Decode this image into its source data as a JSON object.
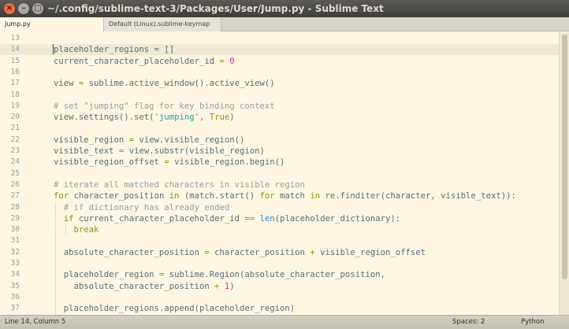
{
  "window": {
    "title": "~/.config/sublime-text-3/Packages/User/Jump.py - Sublime Text",
    "controls": [
      "×",
      "–",
      "□"
    ]
  },
  "tabs": [
    {
      "label": "Jump.py",
      "active": true
    },
    {
      "label": "Default (Linux).sublime-keymap",
      "active": false
    }
  ],
  "editor": {
    "current_line": 14,
    "lines": [
      {
        "n": "13",
        "tokens": []
      },
      {
        "n": "14",
        "tokens": [
          [
            "",
            "placeholder_regions = []"
          ]
        ]
      },
      {
        "n": "15",
        "tokens": [
          [
            "",
            "current_character_placeholder_id "
          ],
          [
            "op",
            "="
          ],
          [
            "",
            " "
          ],
          [
            "num",
            "0"
          ]
        ]
      },
      {
        "n": "16",
        "tokens": []
      },
      {
        "n": "17",
        "tokens": [
          [
            "",
            "view "
          ],
          [
            "op",
            "="
          ],
          [
            "",
            " sublime.active_window().active_view()"
          ]
        ]
      },
      {
        "n": "18",
        "tokens": []
      },
      {
        "n": "19",
        "tokens": [
          [
            "cmt",
            "# set \"jumping\" flag for key binding context"
          ]
        ]
      },
      {
        "n": "20",
        "tokens": [
          [
            "",
            "view.settings().set("
          ],
          [
            "str",
            "'jumping'"
          ],
          [
            "",
            ", "
          ],
          [
            "bool",
            "True"
          ],
          [
            "",
            ")"
          ]
        ]
      },
      {
        "n": "21",
        "tokens": []
      },
      {
        "n": "22",
        "tokens": [
          [
            "",
            "visible_region "
          ],
          [
            "op",
            "="
          ],
          [
            "",
            " view.visible_region()"
          ]
        ]
      },
      {
        "n": "23",
        "tokens": [
          [
            "",
            "visible_text "
          ],
          [
            "op",
            "="
          ],
          [
            "",
            " view.substr(visible_region)"
          ]
        ]
      },
      {
        "n": "24",
        "tokens": [
          [
            "",
            "visible_region_offset "
          ],
          [
            "op",
            "="
          ],
          [
            "",
            " visible_region.begin()"
          ]
        ]
      },
      {
        "n": "25",
        "tokens": []
      },
      {
        "n": "26",
        "tokens": [
          [
            "cmt",
            "# iterate all matched characters in visible region"
          ]
        ]
      },
      {
        "n": "27",
        "tokens": [
          [
            "kw",
            "for"
          ],
          [
            "",
            " character_position "
          ],
          [
            "kw",
            "in"
          ],
          [
            "",
            " (match.start() "
          ],
          [
            "kw",
            "for"
          ],
          [
            "",
            " match "
          ],
          [
            "kw",
            "in"
          ],
          [
            "",
            " re.finditer(character, visible_text)):"
          ]
        ]
      },
      {
        "n": "28",
        "tokens": [
          [
            "",
            "  "
          ],
          [
            "cmt",
            "# if dictionary has already ended"
          ]
        ]
      },
      {
        "n": "29",
        "tokens": [
          [
            "",
            "  "
          ],
          [
            "kw",
            "if"
          ],
          [
            "",
            " current_character_placeholder_id "
          ],
          [
            "op",
            "=="
          ],
          [
            "",
            " "
          ],
          [
            "fn",
            "len"
          ],
          [
            "",
            "(placeholder_dictionary):"
          ]
        ]
      },
      {
        "n": "30",
        "tokens": [
          [
            "",
            "    "
          ],
          [
            "kw",
            "break"
          ]
        ]
      },
      {
        "n": "31",
        "tokens": []
      },
      {
        "n": "32",
        "tokens": [
          [
            "",
            "  absolute_character_position "
          ],
          [
            "op",
            "="
          ],
          [
            "",
            " character_position "
          ],
          [
            "op",
            "+"
          ],
          [
            "",
            " visible_region_offset"
          ]
        ]
      },
      {
        "n": "33",
        "tokens": []
      },
      {
        "n": "34",
        "tokens": [
          [
            "",
            "  placeholder_region "
          ],
          [
            "op",
            "="
          ],
          [
            "",
            " sublime.Region(absolute_character_position,"
          ]
        ]
      },
      {
        "n": "35",
        "tokens": [
          [
            "",
            "    absolute_character_position "
          ],
          [
            "op",
            "+"
          ],
          [
            "",
            " "
          ],
          [
            "num",
            "1"
          ],
          [
            "",
            ")"
          ]
        ]
      },
      {
        "n": "36",
        "tokens": []
      },
      {
        "n": "37",
        "tokens": [
          [
            "",
            "  placeholder_regions.append(placeholder_region)"
          ]
        ]
      }
    ]
  },
  "status": {
    "position": "Line 14, Column 5",
    "spaces": "Spaces: 2",
    "syntax": "Python"
  },
  "scroll": {
    "position": 0.0,
    "visible_fraction": 0.88
  },
  "colors": {
    "background": "#fdf6e3",
    "keyword": "#859900",
    "string": "#2aa198",
    "number": "#d33682",
    "constant": "#b58900",
    "comment": "#93a1a1",
    "function": "#268bd2"
  }
}
